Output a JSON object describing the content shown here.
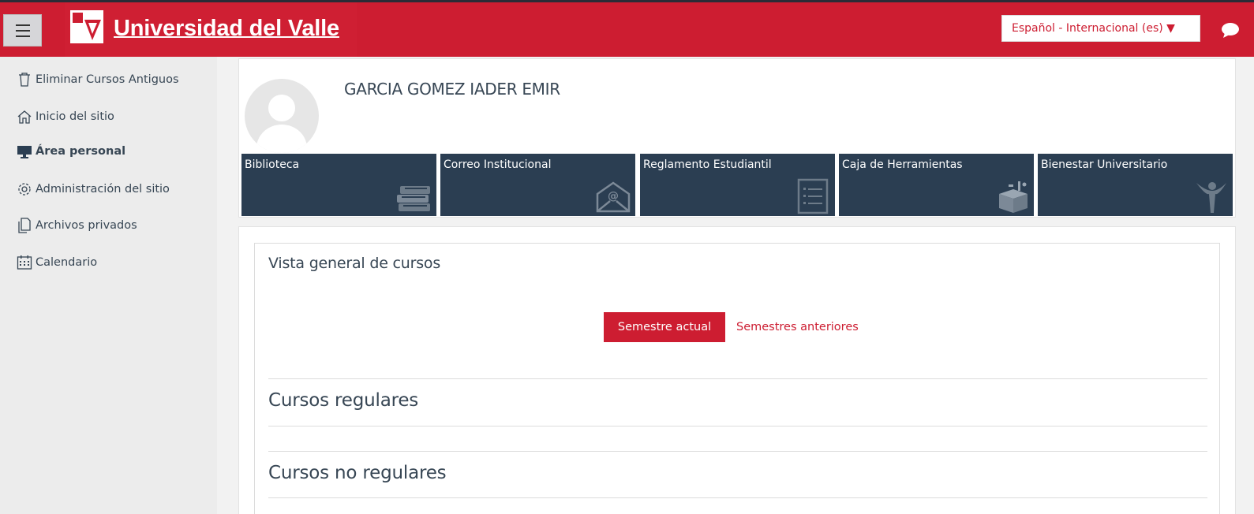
{
  "header": {
    "brand_name": "Universidad del Valle",
    "language_label": "Español - Internacional (es) ▼",
    "accent": "#cd1d31"
  },
  "sidebar": {
    "items": [
      {
        "label": "Eliminar Cursos Antiguos",
        "icon": "trash-icon"
      },
      {
        "label": "Inicio del sitio",
        "icon": "home-icon"
      },
      {
        "label": "Área personal",
        "icon": "desktop-icon",
        "active": true
      },
      {
        "label": "Administración del sitio",
        "icon": "gear-icon"
      },
      {
        "label": "Archivos privados",
        "icon": "files-icon"
      },
      {
        "label": "Calendario",
        "icon": "calendar-icon"
      }
    ]
  },
  "profile": {
    "name": "GARCIA GOMEZ IADER EMIR"
  },
  "tiles": [
    {
      "label": "Biblioteca",
      "icon": "books-icon"
    },
    {
      "label": "Correo Institucional",
      "icon": "mail-icon"
    },
    {
      "label": "Reglamento Estudiantil",
      "icon": "list-icon"
    },
    {
      "label": "Caja de Herramientas",
      "icon": "toolbox-icon"
    },
    {
      "label": "Bienestar Universitario",
      "icon": "person-icon"
    }
  ],
  "overview": {
    "title": "Vista general de cursos",
    "tab_current": "Semestre actual",
    "tab_previous": "Semestres anteriores",
    "section_regular": "Cursos regulares",
    "section_nonregular": "Cursos no regulares"
  }
}
